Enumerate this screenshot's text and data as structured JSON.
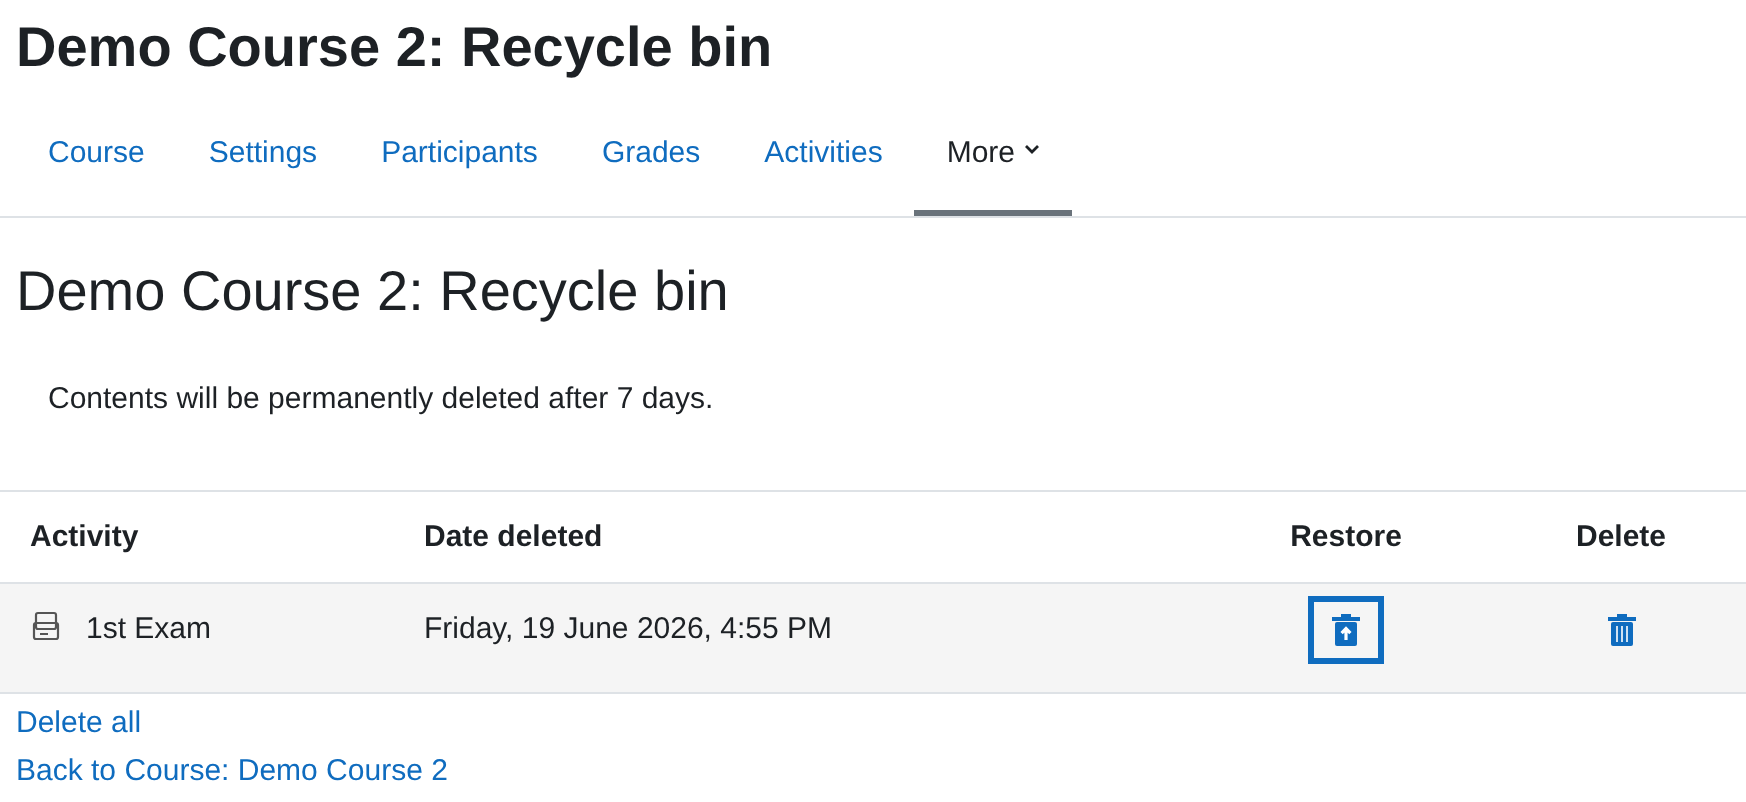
{
  "page_title": "Demo Course 2: Recycle bin",
  "tabs": [
    {
      "label": "Course",
      "selected": false
    },
    {
      "label": "Settings",
      "selected": false
    },
    {
      "label": "Participants",
      "selected": false
    },
    {
      "label": "Grades",
      "selected": false
    },
    {
      "label": "Activities",
      "selected": false
    },
    {
      "label": "More",
      "selected": true,
      "kind": "dropdown"
    }
  ],
  "heading": "Demo Course 2: Recycle bin",
  "notice": "Contents will be permanently deleted after 7 days.",
  "table": {
    "columns": [
      "Activity",
      "Date deleted",
      "Restore",
      "Delete"
    ],
    "rows": [
      {
        "activity": "1st Exam",
        "date_deleted": "Friday, 19 June 2026, 4:55 PM",
        "restore_focused": true
      }
    ]
  },
  "links": [
    "Delete all",
    "Back to Course: Demo Course 2"
  ]
}
